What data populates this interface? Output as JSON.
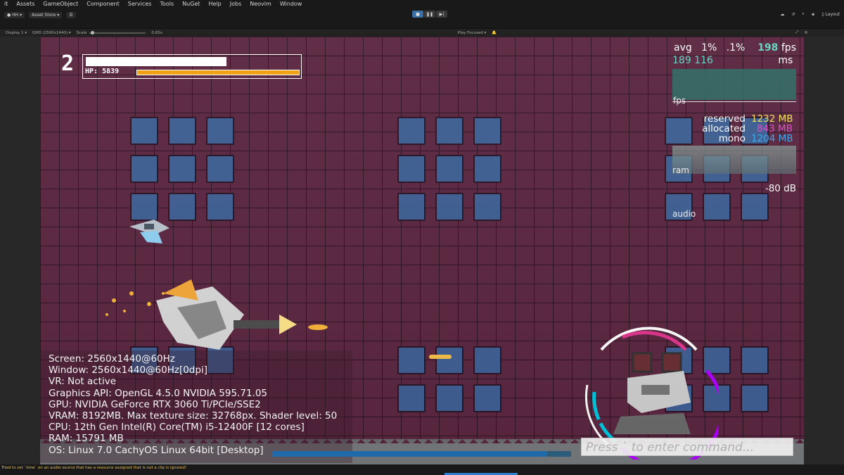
{
  "menu": {
    "items": [
      "it",
      "Assets",
      "GameObject",
      "Component",
      "Services",
      "Tools",
      "NuGet",
      "Help",
      "Jobs",
      "Neovim",
      "Window"
    ]
  },
  "toolbar": {
    "account_label": "HH",
    "asset_store_label": "Asset Store",
    "layout_label": "Layout"
  },
  "gameview": {
    "display_label": "Display 1",
    "resolution_label": "QHD (2560x1440)",
    "scale_label": "Scale",
    "scale_value": "0.65x",
    "play_focused_label": "Play Focused"
  },
  "hud": {
    "level": "2",
    "hp_label": "HP:",
    "hp_value": "5839"
  },
  "perf": {
    "row1_avg": "avg",
    "row1_p1": "1%",
    "row1_p01": ".1%",
    "row1_fps_value": "198",
    "row1_fps_unit": "fps",
    "row2_values": "189 116",
    "row2_ms": "ms",
    "fps_label": "fps",
    "reserved_label": "reserved",
    "reserved_value": "1232 MB",
    "allocated_label": "allocated",
    "allocated_value": "843 MB",
    "mono_label": "mono",
    "mono_value": "1204 MB",
    "ram_label": "ram",
    "audio_db": "-80 dB",
    "audio_label": "audio",
    "colors": {
      "fps": "#5fd7c0",
      "reserved": "#f2e25a",
      "allocated": "#e050c8",
      "mono": "#3fa8ef"
    }
  },
  "sysinfo": {
    "lines": [
      "Screen: 2560x1440@60Hz",
      "Window: 2560x1440@60Hz[0dpi]",
      "VR: Not active",
      "Graphics API: OpenGL 4.5.0 NVIDIA 595.71.05",
      "GPU: NVIDIA GeForce RTX 3060 Ti/PCIe/SSE2",
      "VRAM: 8192MB. Max texture size: 32768px. Shader level: 50",
      "CPU: 12th Gen Intel(R) Core(TM) i5-12400F [12 cores]",
      "RAM: 15791 MB",
      "OS: Linux 7.0 CachyOS Linux  64bit [Desktop]"
    ]
  },
  "console": {
    "placeholder": "Press ` to enter command..."
  },
  "status": {
    "message": "Tried to set `time` on an audio source that has a resource assigned that is not a clip is ignored!"
  }
}
